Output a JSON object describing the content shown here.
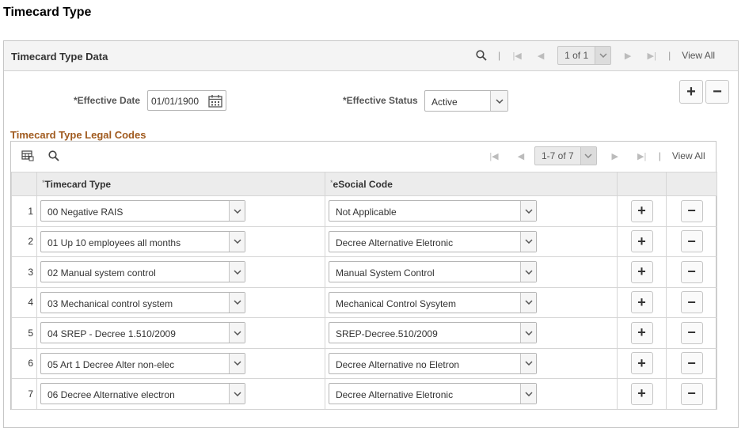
{
  "page": {
    "title": "Timecard Type"
  },
  "outer": {
    "header_title": "Timecard Type Data",
    "pager_text": "1 of 1",
    "view_all": "View All"
  },
  "form": {
    "effective_date_label": "*Effective Date",
    "effective_date_value": "01/01/1900",
    "effective_status_label": "*Effective Status",
    "effective_status_value": "Active",
    "add_symbol": "+",
    "remove_symbol": "−"
  },
  "grid": {
    "title": "Timecard Type Legal Codes",
    "pager_text": "1-7 of 7",
    "view_all": "View All",
    "columns": {
      "timecard_type": "Timecard Type",
      "esocial_code": "eSocial Code",
      "required_mark": "*"
    },
    "rows": [
      {
        "num": "1",
        "timecard_type": "00 Negative RAIS",
        "esocial_code": "Not Applicable"
      },
      {
        "num": "2",
        "timecard_type": "01 Up 10 employees all months",
        "esocial_code": "Decree Alternative Eletronic"
      },
      {
        "num": "3",
        "timecard_type": "02 Manual system control",
        "esocial_code": "Manual System Control"
      },
      {
        "num": "4",
        "timecard_type": "03 Mechanical control system",
        "esocial_code": "Mechanical Control Sysytem"
      },
      {
        "num": "5",
        "timecard_type": "04 SREP - Decree 1.510/2009",
        "esocial_code": "SREP-Decree.510/2009"
      },
      {
        "num": "6",
        "timecard_type": "05 Art 1 Decree Alter non-elec",
        "esocial_code": "Decree Alternative no Eletron"
      },
      {
        "num": "7",
        "timecard_type": "06 Decree Alternative electron",
        "esocial_code": "Decree Alternative Eletronic"
      }
    ]
  }
}
